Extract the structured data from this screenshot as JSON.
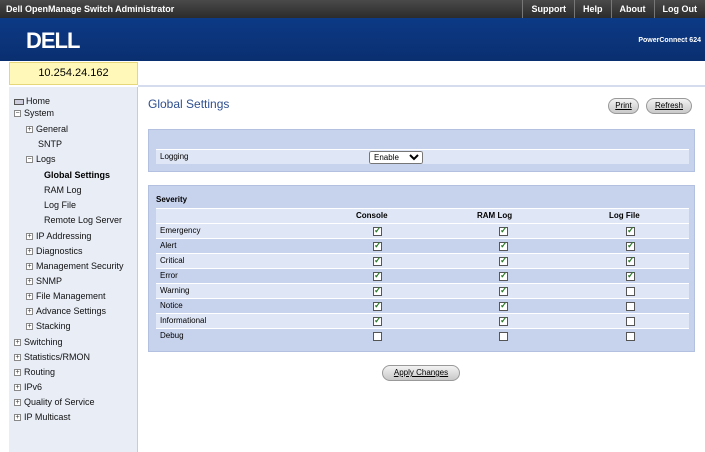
{
  "topbar": {
    "title": "Dell OpenManage Switch Administrator",
    "links": [
      "Support",
      "Help",
      "About",
      "Log Out"
    ]
  },
  "header": {
    "logo": "DELL",
    "model": "PowerConnect 624"
  },
  "ip_address": "10.254.24.162",
  "sidebar": {
    "items": [
      {
        "label": "Home",
        "icon": "home-icon"
      },
      {
        "label": "System",
        "expander": "−"
      },
      {
        "label": "General",
        "expander": "+"
      },
      {
        "label": "SNTP"
      },
      {
        "label": "Logs",
        "expander": "−"
      },
      {
        "label": "Global Settings"
      },
      {
        "label": "RAM Log"
      },
      {
        "label": "Log File"
      },
      {
        "label": "Remote Log Server"
      },
      {
        "label": "IP Addressing",
        "expander": "+"
      },
      {
        "label": "Diagnostics",
        "expander": "+"
      },
      {
        "label": "Management Security",
        "expander": "+"
      },
      {
        "label": "SNMP",
        "expander": "+"
      },
      {
        "label": "File Management",
        "expander": "+"
      },
      {
        "label": "Advance Settings",
        "expander": "+"
      },
      {
        "label": "Stacking",
        "expander": "+"
      },
      {
        "label": "Switching",
        "expander": "+"
      },
      {
        "label": "Statistics/RMON",
        "expander": "+"
      },
      {
        "label": "Routing",
        "expander": "+"
      },
      {
        "label": "IPv6",
        "expander": "+"
      },
      {
        "label": "Quality of Service",
        "expander": "+"
      },
      {
        "label": "IP Multicast",
        "expander": "+"
      }
    ]
  },
  "main": {
    "title": "Global Settings",
    "print_label": "Print",
    "refresh_label": "Refresh",
    "logging_label": "Logging",
    "logging_value": "Enable",
    "severity_heading": "Severity",
    "columns": [
      "Console",
      "RAM Log",
      "Log File"
    ],
    "rows": [
      {
        "name": "Emergency",
        "values": [
          true,
          true,
          true
        ]
      },
      {
        "name": "Alert",
        "values": [
          true,
          true,
          true
        ]
      },
      {
        "name": "Critical",
        "values": [
          true,
          true,
          true
        ]
      },
      {
        "name": "Error",
        "values": [
          true,
          true,
          true
        ]
      },
      {
        "name": "Warning",
        "values": [
          true,
          true,
          false
        ]
      },
      {
        "name": "Notice",
        "values": [
          true,
          true,
          false
        ]
      },
      {
        "name": "Informational",
        "values": [
          true,
          true,
          false
        ]
      },
      {
        "name": "Debug",
        "values": [
          false,
          false,
          false
        ]
      }
    ],
    "apply_label": "Apply Changes"
  },
  "colors": {
    "header_blue": "#0c3a86",
    "panel_blue": "#c7d2ec",
    "title_blue": "#2f4f8f",
    "ip_yellow": "#fff8b8"
  }
}
